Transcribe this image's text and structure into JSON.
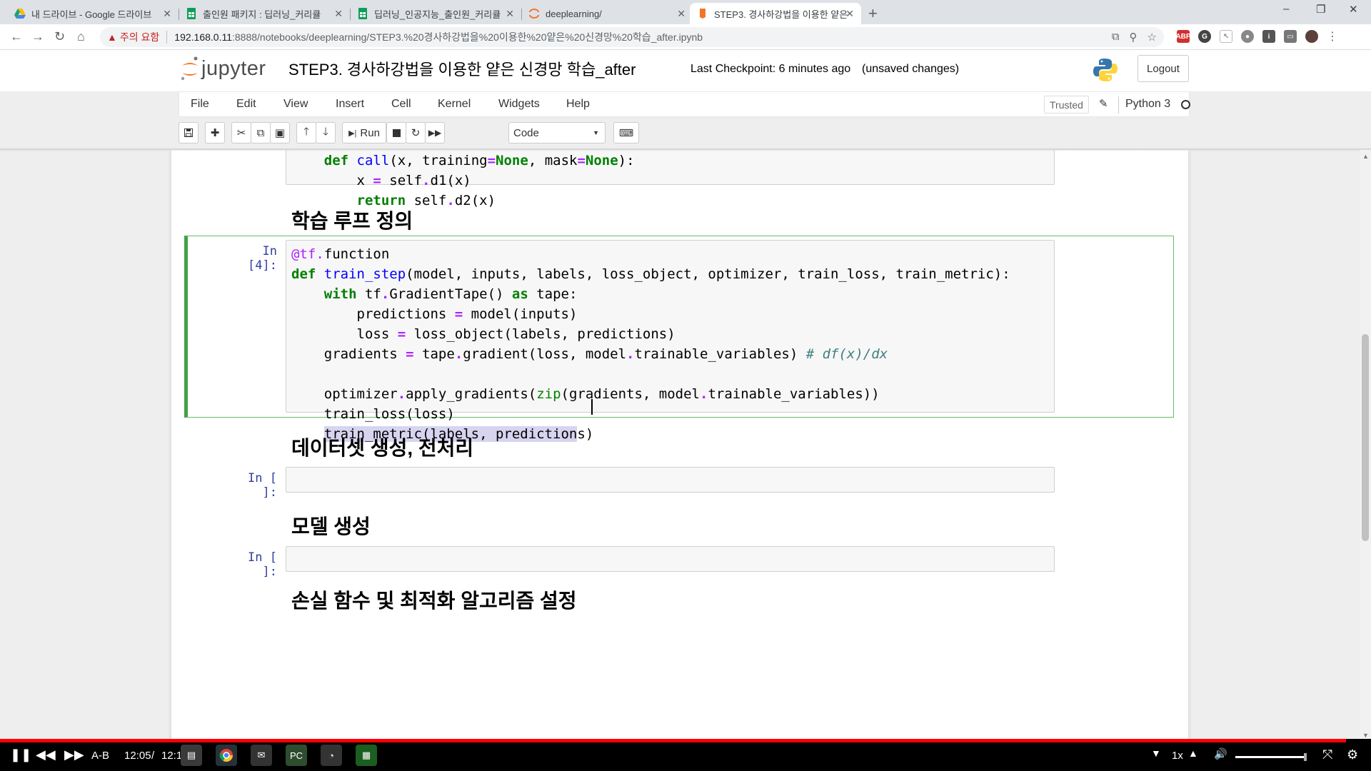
{
  "browser": {
    "tabs": [
      {
        "title": "내 드라이브 - Google 드라이브",
        "icon": "google-drive-icon"
      },
      {
        "title": "출인원 패키지 : 딥러닝_커리큘",
        "icon": "sheets-icon"
      },
      {
        "title": "딥러닝_인공지능_출인원_커리큘",
        "icon": "sheets-icon"
      },
      {
        "title": "deeplearning/",
        "icon": "jupyter-icon"
      },
      {
        "title": "STEP3. 경사하강법을 이용한 얕은",
        "icon": "jupyter-notebook-icon",
        "active": true
      }
    ],
    "new_tab": "+",
    "security_warning": "주의 요함",
    "url_host": "192.168.0.11",
    "url_rest": ":8888/notebooks/deeplearning/STEP3.%20경사하강법을%20이용한%20얕은%20신경망%20학습_after.ipynb",
    "window_controls": [
      "–",
      "❐",
      "✕"
    ]
  },
  "jupyter": {
    "brand": "jupyter",
    "notebook_title": "STEP3. 경사하강법을 이용한 얕은 신경망 학습_after",
    "checkpoint": "Last Checkpoint: 6 minutes ago",
    "unsaved": "(unsaved changes)",
    "logout": "Logout",
    "menu": [
      "File",
      "Edit",
      "View",
      "Insert",
      "Cell",
      "Kernel",
      "Widgets",
      "Help"
    ],
    "trusted": "Trusted",
    "kernel": "Python 3",
    "toolbar": {
      "run_label": "Run",
      "cell_type": "Code"
    }
  },
  "cells": {
    "cell0_code": "    def call(x, training=None, mask=None):\n        x = self.d1(x)\n        return self.d2(x)",
    "md1": "학습 루프 정의",
    "cell4_prompt": "In [4]:",
    "md2": "데이터셋 생성, 전처리",
    "empty1_prompt": "In [ ]:",
    "md3": "모델 생성",
    "empty2_prompt": "In [ ]:",
    "md4": "손실 함수 및 최적화 알고리즘 설정"
  },
  "player": {
    "ab": "A-B",
    "time_current": "12:05",
    "time_sep": "/",
    "time_total": "12:18",
    "speed": "1x",
    "progress": 0.982
  }
}
